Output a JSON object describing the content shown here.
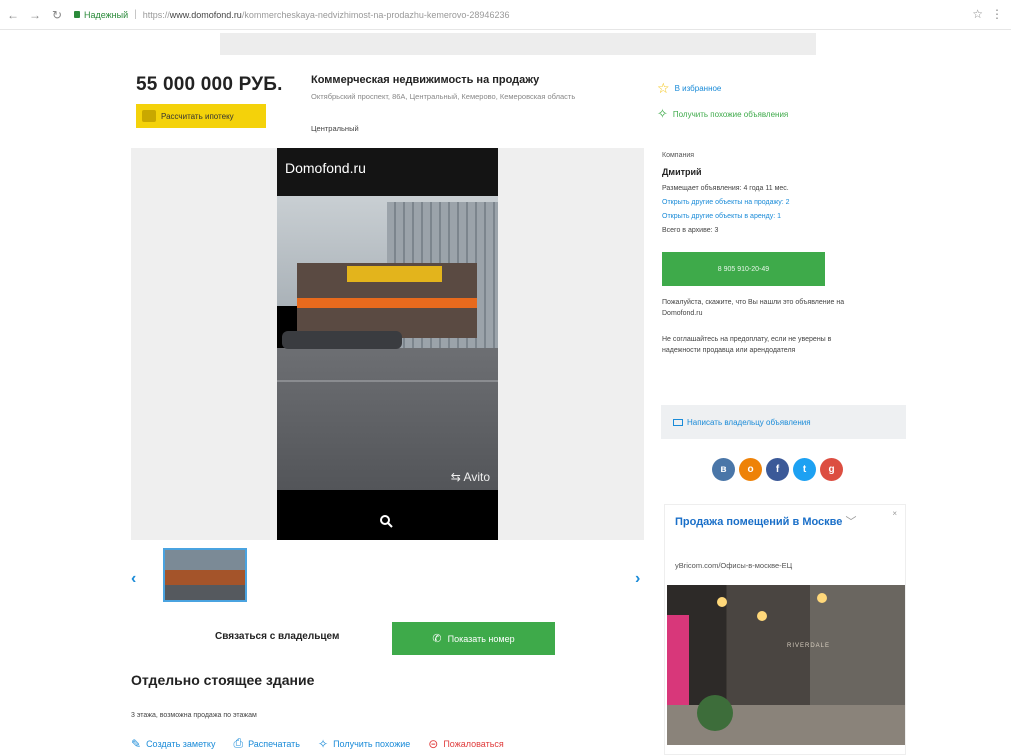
{
  "browser": {
    "secure_label": "Надежный",
    "url_prefix": "https://",
    "url_host": "www.domofond.ru",
    "url_path": "/kommercheskaya-nedvizhimost-na-prodazhu-kemerovo-28946236"
  },
  "listing": {
    "price": "55 000 000 РУБ.",
    "mortgage_label": "Рассчитать ипотеку",
    "title": "Коммерческая недвижимость на продажу",
    "address": "Октябрьский проспект, 86А, Центральный, Кемерово, Кемеровская область",
    "district": "Центральный",
    "photo_logo": "Domofond.ru",
    "photo_watermark": "Avito",
    "contact_label": "Связаться с владельцем",
    "show_phone_label": "Показать номер",
    "heading": "Отдельно стоящее здание",
    "floors_text": "3 этажа, возможна продажа по этажам",
    "actions": {
      "note": "Создать заметку",
      "print": "Распечатать",
      "similar": "Получить похожие",
      "complain": "Пожаловаться"
    }
  },
  "sidebar": {
    "favorite_label": "В избранное",
    "similar_label": "Получить похожие объявления",
    "company_label": "Компания",
    "seller_name": "Дмитрий",
    "posting_since": "Размещает объявления: 4 года 11 мес.",
    "link_sale": "Открыть другие объекты на продажу: 2",
    "link_rent": "Открыть другие объекты в аренду: 1",
    "total_archive": "Всего в архиве: 3",
    "phone_button": "8 905 910-20-49",
    "note1": "Пожалуйста, скажите, что Вы нашли это объявление на Domofond.ru",
    "note2": "Не соглашайтесь на предоплату, если не уверены в надежности продавца или арендодателя",
    "write_owner": "Написать владельцу объявления",
    "social": [
      {
        "icon": "vk-icon",
        "glyph": "в",
        "color": "#4a76a8"
      },
      {
        "icon": "ok-icon",
        "glyph": "o",
        "color": "#ee8208"
      },
      {
        "icon": "facebook-icon",
        "glyph": "f",
        "color": "#3b5998"
      },
      {
        "icon": "twitter-icon",
        "glyph": "t",
        "color": "#1da1f2"
      },
      {
        "icon": "google-plus-icon",
        "glyph": "g",
        "color": "#dc4e41"
      }
    ]
  },
  "ad": {
    "title": "Продажа помещений в Москве",
    "domain": "yBricom.com/Офисы-в-москве-ЕЦ",
    "brand_text": "RIVERDALE"
  }
}
